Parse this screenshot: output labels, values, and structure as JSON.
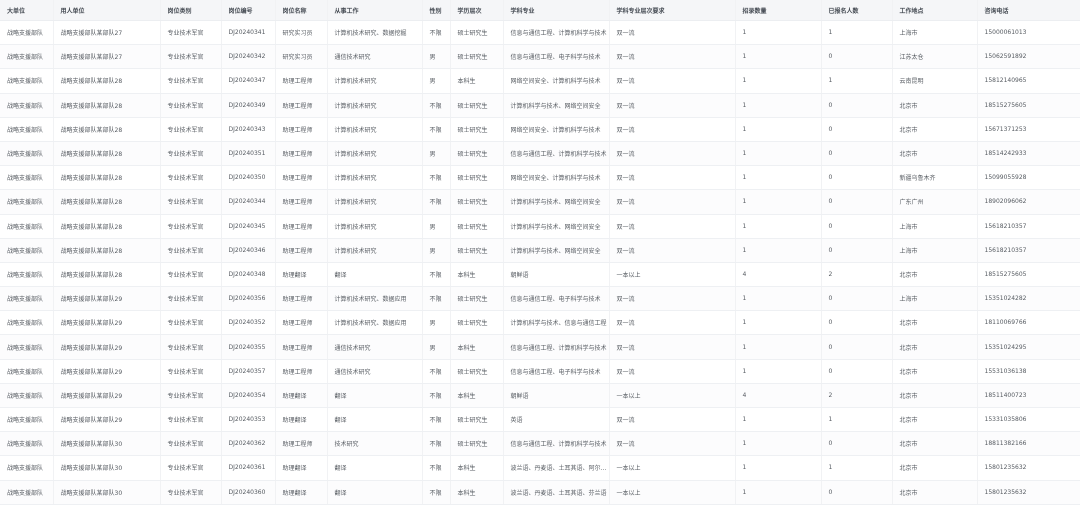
{
  "columns": [
    "大单位",
    "用人单位",
    "岗位类别",
    "岗位编号",
    "岗位名称",
    "从事工作",
    "性别",
    "学历层次",
    "学科专业",
    "学科专业层次要求",
    "招录数量",
    "已报名人数",
    "工作地点",
    "咨询电话"
  ],
  "rows": [
    [
      "战略支援部队",
      "战略支援部队某部队27",
      "专业技术军官",
      "DJ20240341",
      "研究实习员",
      "计算机技术研究、数据挖掘",
      "不限",
      "硕士研究生",
      "信息与通信工程、计算机科学与技术",
      "双一流",
      "1",
      "1",
      "上海市",
      "15000061013"
    ],
    [
      "战略支援部队",
      "战略支援部队某部队27",
      "专业技术军官",
      "DJ20240342",
      "研究实习员",
      "通信技术研究",
      "男",
      "硕士研究生",
      "信息与通信工程、电子科学与技术",
      "双一流",
      "1",
      "0",
      "江苏太仓",
      "15062591892"
    ],
    [
      "战略支援部队",
      "战略支援部队某部队28",
      "专业技术军官",
      "DJ20240347",
      "助理工程师",
      "计算机技术研究",
      "男",
      "本科生",
      "网络空间安全、计算机科学与技术",
      "双一流",
      "1",
      "1",
      "云南昆明",
      "15812140965"
    ],
    [
      "战略支援部队",
      "战略支援部队某部队28",
      "专业技术军官",
      "DJ20240349",
      "助理工程师",
      "计算机技术研究",
      "不限",
      "硕士研究生",
      "计算机科学与技术、网络空间安全",
      "双一流",
      "1",
      "0",
      "北京市",
      "18515275605"
    ],
    [
      "战略支援部队",
      "战略支援部队某部队28",
      "专业技术军官",
      "DJ20240343",
      "助理工程师",
      "计算机技术研究",
      "不限",
      "硕士研究生",
      "网络空间安全、计算机科学与技术",
      "双一流",
      "1",
      "0",
      "北京市",
      "15671371253"
    ],
    [
      "战略支援部队",
      "战略支援部队某部队28",
      "专业技术军官",
      "DJ20240351",
      "助理工程师",
      "计算机技术研究",
      "男",
      "硕士研究生",
      "信息与通信工程、计算机科学与技术",
      "双一流",
      "1",
      "0",
      "北京市",
      "18514242933"
    ],
    [
      "战略支援部队",
      "战略支援部队某部队28",
      "专业技术军官",
      "DJ20240350",
      "助理工程师",
      "计算机技术研究",
      "不限",
      "硕士研究生",
      "网络空间安全、计算机科学与技术",
      "双一流",
      "1",
      "0",
      "新疆乌鲁木齐",
      "15099055928"
    ],
    [
      "战略支援部队",
      "战略支援部队某部队28",
      "专业技术军官",
      "DJ20240344",
      "助理工程师",
      "计算机技术研究",
      "不限",
      "硕士研究生",
      "计算机科学与技术、网络空间安全",
      "双一流",
      "1",
      "0",
      "广东广州",
      "18902096062"
    ],
    [
      "战略支援部队",
      "战略支援部队某部队28",
      "专业技术军官",
      "DJ20240345",
      "助理工程师",
      "计算机技术研究",
      "男",
      "硕士研究生",
      "计算机科学与技术、网络空间安全",
      "双一流",
      "1",
      "0",
      "上海市",
      "15618210357"
    ],
    [
      "战略支援部队",
      "战略支援部队某部队28",
      "专业技术军官",
      "DJ20240346",
      "助理工程师",
      "计算机技术研究",
      "男",
      "硕士研究生",
      "计算机科学与技术、网络空间安全",
      "双一流",
      "1",
      "0",
      "上海市",
      "15618210357"
    ],
    [
      "战略支援部队",
      "战略支援部队某部队28",
      "专业技术军官",
      "DJ20240348",
      "助理翻译",
      "翻译",
      "不限",
      "本科生",
      "朝鲜语",
      "一本以上",
      "4",
      "2",
      "北京市",
      "18515275605"
    ],
    [
      "战略支援部队",
      "战略支援部队某部队29",
      "专业技术军官",
      "DJ20240356",
      "助理工程师",
      "计算机技术研究、数据应用",
      "不限",
      "硕士研究生",
      "信息与通信工程、电子科学与技术",
      "双一流",
      "1",
      "0",
      "上海市",
      "15351024282"
    ],
    [
      "战略支援部队",
      "战略支援部队某部队29",
      "专业技术军官",
      "DJ20240352",
      "助理工程师",
      "计算机技术研究、数据应用",
      "男",
      "硕士研究生",
      "计算机科学与技术、信息与通信工程",
      "双一流",
      "1",
      "0",
      "北京市",
      "18110069766"
    ],
    [
      "战略支援部队",
      "战略支援部队某部队29",
      "专业技术军官",
      "DJ20240355",
      "助理工程师",
      "通信技术研究",
      "男",
      "本科生",
      "信息与通信工程、计算机科学与技术",
      "双一流",
      "1",
      "0",
      "北京市",
      "15351024295"
    ],
    [
      "战略支援部队",
      "战略支援部队某部队29",
      "专业技术军官",
      "DJ20240357",
      "助理工程师",
      "通信技术研究",
      "不限",
      "硕士研究生",
      "信息与通信工程、电子科学与技术",
      "双一流",
      "1",
      "0",
      "北京市",
      "15531036138"
    ],
    [
      "战略支援部队",
      "战略支援部队某部队29",
      "专业技术军官",
      "DJ20240354",
      "助理翻译",
      "翻译",
      "不限",
      "本科生",
      "朝鲜语",
      "一本以上",
      "4",
      "2",
      "北京市",
      "18511400723"
    ],
    [
      "战略支援部队",
      "战略支援部队某部队29",
      "专业技术军官",
      "DJ20240353",
      "助理翻译",
      "翻译",
      "不限",
      "硕士研究生",
      "英语",
      "双一流",
      "1",
      "1",
      "北京市",
      "15331035806"
    ],
    [
      "战略支援部队",
      "战略支援部队某部队30",
      "专业技术军官",
      "DJ20240362",
      "助理工程师",
      "技术研究",
      "不限",
      "硕士研究生",
      "信息与通信工程、计算机科学与技术",
      "双一流",
      "1",
      "0",
      "北京市",
      "18811382166"
    ],
    [
      "战略支援部队",
      "战略支援部队某部队30",
      "专业技术军官",
      "DJ20240361",
      "助理翻译",
      "翻译",
      "不限",
      "本科生",
      "波兰语、丹麦语、土耳其语、阿尔巴尼亚语",
      "一本以上",
      "1",
      "1",
      "北京市",
      "15801235632"
    ],
    [
      "战略支援部队",
      "战略支援部队某部队30",
      "专业技术军官",
      "DJ20240360",
      "助理翻译",
      "翻译",
      "不限",
      "本科生",
      "波兰语、丹麦语、土耳其语、芬兰语",
      "一本以上",
      "1",
      "0",
      "北京市",
      "15801235632"
    ]
  ]
}
